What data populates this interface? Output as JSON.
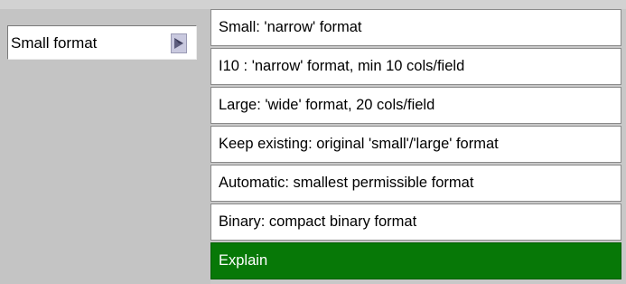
{
  "selector": {
    "value": "Small format",
    "button_icon": "triangle-right-icon"
  },
  "menu": {
    "items": [
      {
        "label": "Small: 'narrow' format"
      },
      {
        "label": "I10  : 'narrow' format, min 10 cols/field"
      },
      {
        "label": "Large: 'wide' format, 20 cols/field"
      },
      {
        "label": "Keep existing: original 'small'/'large' format"
      },
      {
        "label": "Automatic: smallest permissible format"
      },
      {
        "label": "Binary: compact binary format"
      },
      {
        "label": "Explain",
        "highlighted": true
      }
    ]
  },
  "colors": {
    "highlight": "#077807",
    "background": "#c8c8c8"
  }
}
